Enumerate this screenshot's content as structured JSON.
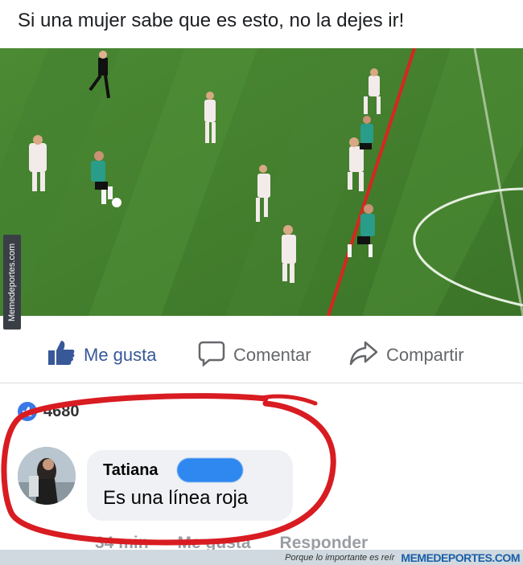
{
  "post": {
    "text": "Si una mujer sabe que es esto, no la dejes ir!"
  },
  "watermark": {
    "side": "Memedeportes.com",
    "slogan": "Porque lo importante es reír",
    "brand": "MEMEDEPORTES.COM"
  },
  "actions": {
    "like_label": "Me gusta",
    "comment_label": "Comentar",
    "share_label": "Compartir"
  },
  "reactions": {
    "count": "4680"
  },
  "comment": {
    "author": "Tatiana",
    "text": "Es una línea roja",
    "time": "34 min",
    "like_label": "Me gusta",
    "reply_label": "Responder"
  },
  "colors": {
    "offside_line": "#d7261f",
    "circle": "#d81c22",
    "like_blue": "#385898"
  },
  "icons": [
    "thumbs-up-icon",
    "comment-icon",
    "share-icon",
    "like-badge-icon"
  ]
}
